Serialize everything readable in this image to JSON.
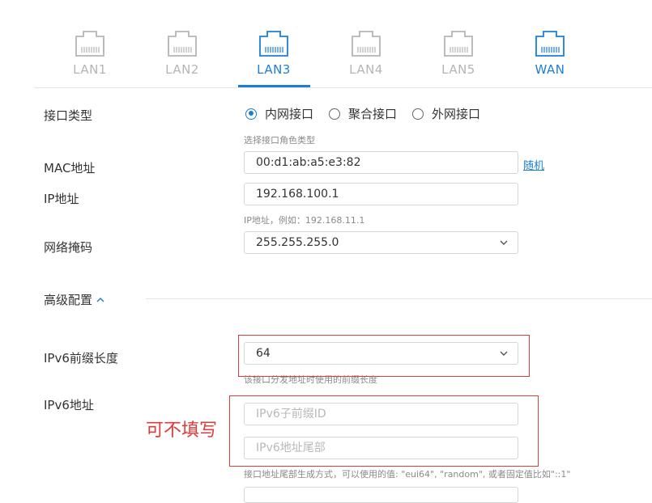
{
  "ports": [
    {
      "label": "LAN1",
      "state": "inactive"
    },
    {
      "label": "LAN2",
      "state": "inactive"
    },
    {
      "label": "LAN3",
      "state": "active"
    },
    {
      "label": "LAN4",
      "state": "inactive"
    },
    {
      "label": "LAN5",
      "state": "inactive"
    },
    {
      "label": "WAN",
      "state": "wan"
    }
  ],
  "colors": {
    "accent": "#1c7fd6",
    "inactive": "#b5b5b5",
    "annotation": "#e03a3a"
  },
  "interface_type": {
    "label": "接口类型",
    "options": [
      "内网接口",
      "聚合接口",
      "外网接口"
    ],
    "selected": "内网接口",
    "hint": "选择接口角色类型"
  },
  "mac": {
    "label": "MAC地址",
    "value": "00:d1:ab:a5:e3:82",
    "random_link": "随机"
  },
  "ip": {
    "label": "IP地址",
    "value": "192.168.100.1",
    "hint": "IP地址，例如：192.168.11.1"
  },
  "netmask": {
    "label": "网络掩码",
    "value": "255.255.255.0"
  },
  "advanced": {
    "label": "高级配置",
    "expanded": true
  },
  "ipv6_prefix_len": {
    "label": "IPv6前缀长度",
    "value": "64",
    "hint": "该接口分发地址时使用的前缀长度"
  },
  "ipv6_addr": {
    "label": "IPv6地址",
    "subnet_placeholder": "IPv6子前缀ID",
    "suffix_placeholder": "IPv6地址尾部",
    "hint": "接口地址尾部生成方式，可以使用的值: \"eui64\", \"random\", 或者固定值比如\"::1\""
  },
  "annotation": {
    "text": "可不填写"
  }
}
